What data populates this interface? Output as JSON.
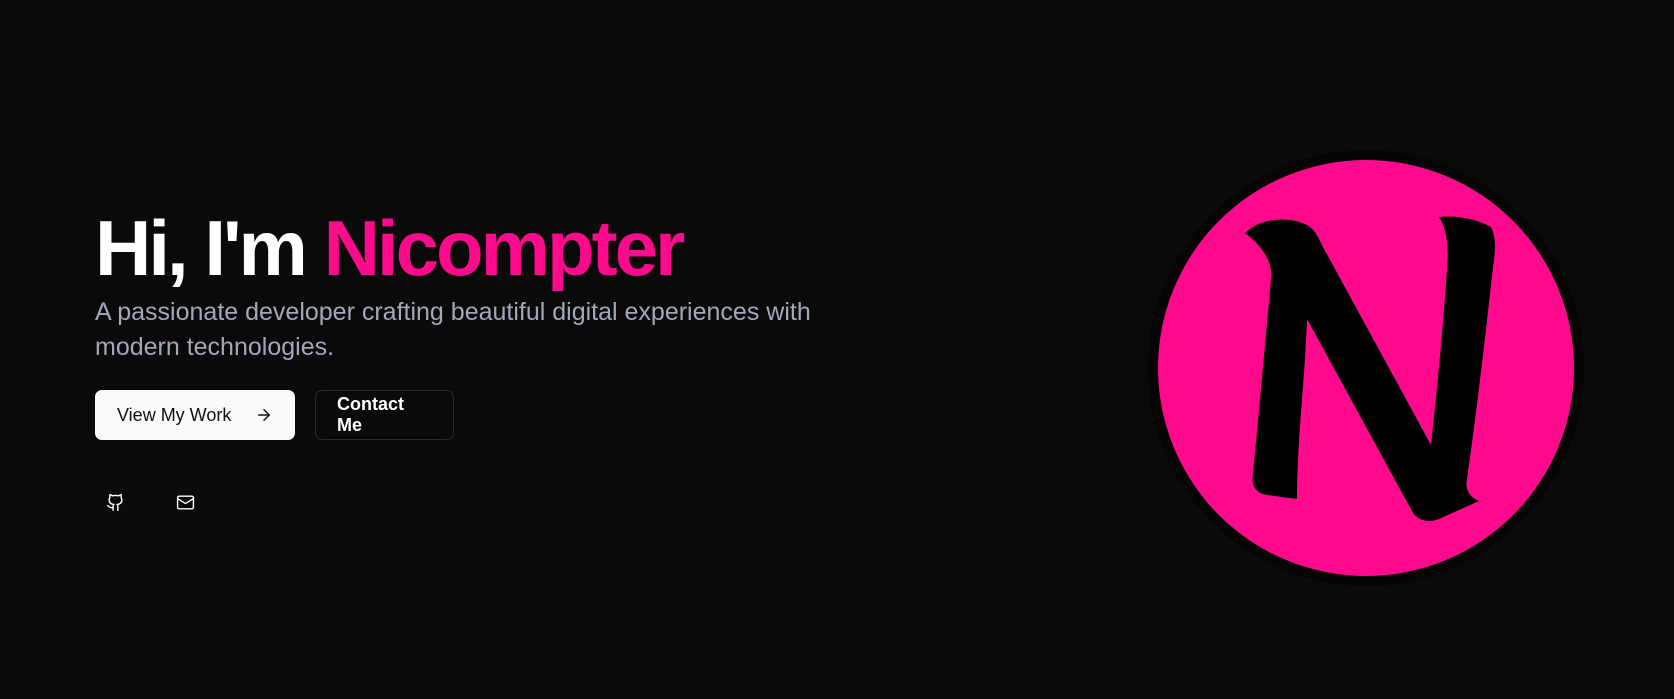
{
  "hero": {
    "greeting": "Hi, I'm",
    "name": "Nicompter",
    "subtitle": "A passionate developer crafting beautiful digital experiences with modern technologies.",
    "primary_button": "View My Work",
    "secondary_button": "Contact Me"
  },
  "socials": [
    {
      "icon": "github-icon"
    },
    {
      "icon": "mail-icon"
    }
  ],
  "logo": {
    "letter": "N"
  },
  "colors": {
    "background": "#0a0a0a",
    "accent": "#ff0a8c",
    "subtitle": "#a1a8b8"
  }
}
